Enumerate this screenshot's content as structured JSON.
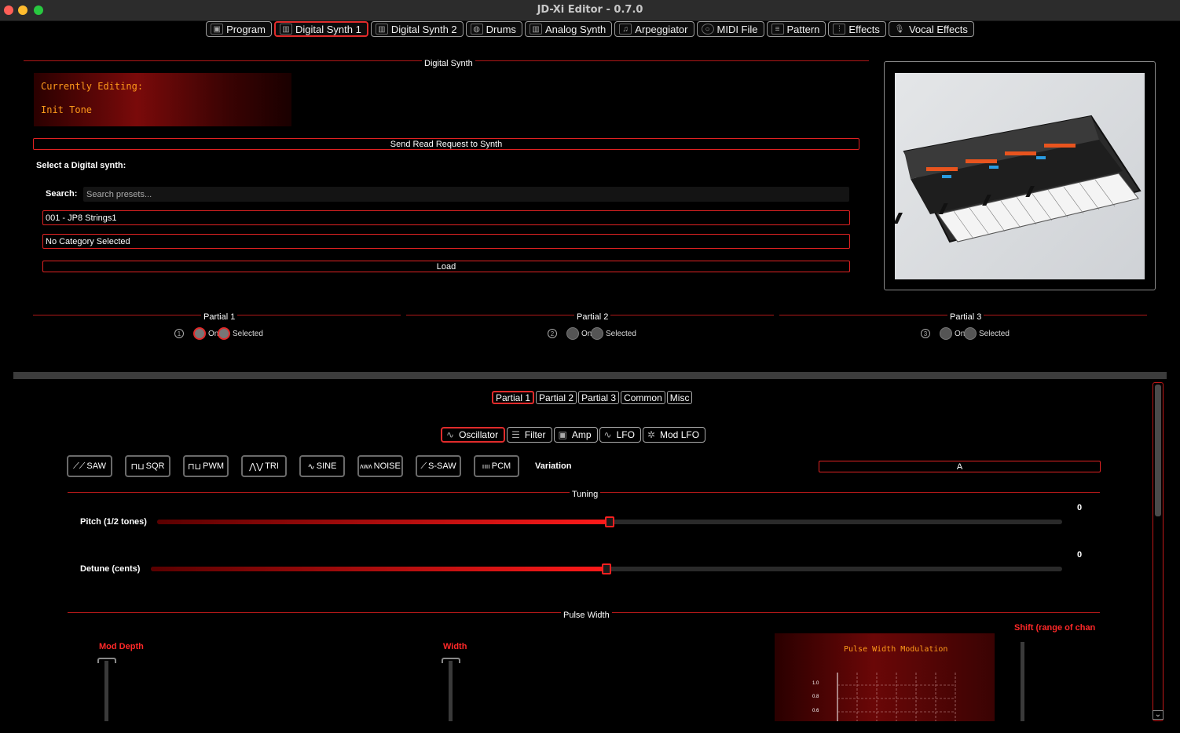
{
  "window": {
    "title": "JD-Xi Editor - 0.7.0"
  },
  "nav": {
    "tabs": [
      {
        "label": "Program",
        "icon": "program-icon"
      },
      {
        "label": "Digital Synth 1",
        "icon": "keyboard-icon",
        "active": true
      },
      {
        "label": "Digital Synth 2",
        "icon": "keyboard-icon"
      },
      {
        "label": "Drums",
        "icon": "drum-icon"
      },
      {
        "label": "Analog Synth",
        "icon": "keyboard-icon"
      },
      {
        "label": "Arpeggiator",
        "icon": "music-note-icon"
      },
      {
        "label": "MIDI File",
        "icon": "midi-icon"
      },
      {
        "label": "Pattern",
        "icon": "pattern-icon"
      },
      {
        "label": "Effects",
        "icon": "sliders-icon"
      },
      {
        "label": "Vocal Effects",
        "icon": "microphone-icon"
      }
    ]
  },
  "digital_synth": {
    "section_title": "Digital Synth",
    "lcd": {
      "line1": "Currently Editing:",
      "line2": "Init Tone"
    },
    "read_request_label": "Send Read Request to Synth",
    "select_label": "Select a Digital synth:",
    "search_label": "Search:",
    "search_placeholder": "Search presets...",
    "preset_value": "001 - JP8 Strings1",
    "category_value": "No Category Selected",
    "load_label": "Load"
  },
  "partials": [
    {
      "title": "Partial 1",
      "number": "1",
      "on_label": "On",
      "selected_label": "Selected",
      "on": true,
      "selected": true
    },
    {
      "title": "Partial 2",
      "number": "2",
      "on_label": "On",
      "selected_label": "Selected",
      "on": false,
      "selected": false
    },
    {
      "title": "Partial 3",
      "number": "3",
      "on_label": "On",
      "selected_label": "Selected",
      "on": false,
      "selected": false
    }
  ],
  "partial_tabs": [
    "Partial 1",
    "Partial 2",
    "Partial 3",
    "Common",
    "Misc"
  ],
  "module_tabs": [
    {
      "label": "Oscillator",
      "icon": "sine-icon",
      "active": true
    },
    {
      "label": "Filter",
      "icon": "filter-icon"
    },
    {
      "label": "Amp",
      "icon": "amp-icon"
    },
    {
      "label": "LFO",
      "icon": "lfo-icon"
    },
    {
      "label": "Mod LFO",
      "icon": "mod-lfo-icon"
    }
  ],
  "waveforms": [
    {
      "label": "SAW",
      "icon": "saw-wave-icon"
    },
    {
      "label": "SQR",
      "icon": "square-wave-icon"
    },
    {
      "label": "PWM",
      "icon": "pwm-wave-icon"
    },
    {
      "label": "TRI",
      "icon": "triangle-wave-icon"
    },
    {
      "label": "SINE",
      "icon": "sine-wave-icon"
    },
    {
      "label": "NOISE",
      "icon": "noise-wave-icon"
    },
    {
      "label": "S-SAW",
      "icon": "supersaw-wave-icon"
    },
    {
      "label": "PCM",
      "icon": "pcm-wave-icon"
    }
  ],
  "variation": {
    "label": "Variation",
    "value": "A"
  },
  "tuning": {
    "section_title": "Tuning",
    "pitch": {
      "label": "Pitch (1/2 tones)",
      "value": "0",
      "level": 0.5
    },
    "detune": {
      "label": "Detune (cents)",
      "value": "0",
      "level": 0.5
    }
  },
  "pulse_width": {
    "section_title": "Pulse Width",
    "mod_depth_label": "Mod Depth",
    "width_label": "Width",
    "shift_label": "Shift (range of chan",
    "plot_title": "Pulse Width Modulation",
    "plot_ticks": [
      "1.0",
      "0.8",
      "0.6"
    ]
  },
  "colors": {
    "accent": "#e02b2b",
    "lcd_text": "#ff9a1a",
    "background": "#000000"
  }
}
